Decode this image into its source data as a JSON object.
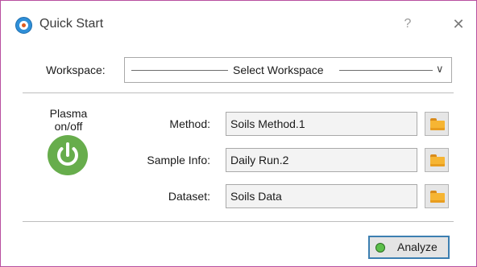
{
  "window": {
    "title": "Quick Start",
    "help": "?",
    "close": "✕"
  },
  "workspace": {
    "label": "Workspace:",
    "selected": "Select Workspace",
    "chevron": "∨"
  },
  "plasma": {
    "label": "Plasma on/off",
    "button_color": "#67ad4c"
  },
  "fields": {
    "method": {
      "label": "Method:",
      "value": "Soils Method.1"
    },
    "sample_info": {
      "label": "Sample Info:",
      "value": "Daily Run.2"
    },
    "dataset": {
      "label": "Dataset:",
      "value": "Soils Data"
    }
  },
  "actions": {
    "analyze_label": "Analyze",
    "analyze_status_color": "#5cbf4a"
  },
  "colors": {
    "window_border": "#b84fa0",
    "focus_border": "#3c7fb1",
    "folder": "#f6b533"
  }
}
